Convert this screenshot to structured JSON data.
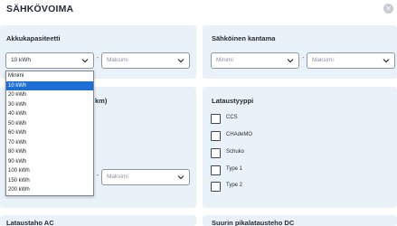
{
  "modal": {
    "title": "SÄHKÖVOIMA",
    "close_icon": "close-icon"
  },
  "battery": {
    "title": "Akkukapasiteetti",
    "min_value": "10 kWh",
    "max_placeholder": "Maksimi",
    "options": [
      "Minimi",
      "10 kWh",
      "20 kWh",
      "30 kWh",
      "40 kWh",
      "50 kWh",
      "60 kWh",
      "70 kWh",
      "80 kWh",
      "90 kWh",
      "100 kWh",
      "150 kWh",
      "200 kWh"
    ],
    "selected_option": "10 kWh"
  },
  "range": {
    "title": "Sähköinen kantama",
    "min_placeholder": "Minimi",
    "max_placeholder": "Maksimi"
  },
  "consumption": {
    "title_fragment": "km)",
    "max_placeholder": "Maksimi"
  },
  "charging_type": {
    "title": "Lataustyyppi",
    "options": [
      "CCS",
      "CHAdeMO",
      "Schuko",
      "Type 1",
      "Type 2"
    ]
  },
  "bottom": {
    "left_title": "Lataustaho  AC",
    "right_title": "Suurin pikalatausteho  DC"
  },
  "separator": "-"
}
